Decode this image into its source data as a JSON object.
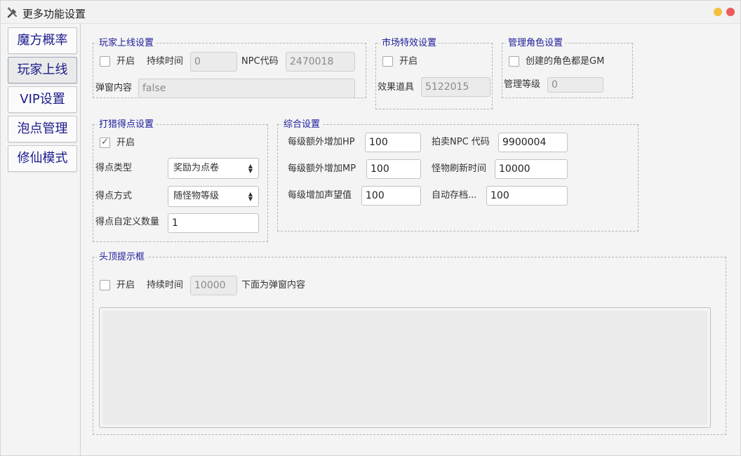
{
  "window": {
    "title": "更多功能设置",
    "colors": {
      "minimize": "#f5bf3e",
      "close": "#f05a5a"
    }
  },
  "sidebar": {
    "items": [
      {
        "label": "魔方概率"
      },
      {
        "label": "玩家上线",
        "active": true
      },
      {
        "label": "VIP设置"
      },
      {
        "label": "泡点管理"
      },
      {
        "label": "修仙模式"
      }
    ]
  },
  "player_online": {
    "legend": "玩家上线设置",
    "enable_label": "开启",
    "enabled": false,
    "duration_label": "持续时间",
    "duration_value": "0",
    "npc_label": "NPC代码",
    "npc_value": "2470018",
    "popup_label": "弹窗内容",
    "popup_value": "false"
  },
  "market": {
    "legend": "市场特效设置",
    "enable_label": "开启",
    "enabled": false,
    "item_label": "效果道具",
    "item_value": "5122015"
  },
  "admin_role": {
    "legend": "管理角色设置",
    "gm_label": "创建的角色都是GM",
    "gm_enabled": false,
    "level_label": "管理等级",
    "level_value": "0"
  },
  "hunting": {
    "legend": "打猎得点设置",
    "enable_label": "开启",
    "enabled": true,
    "type_label": "得点类型",
    "type_value": "奖励为点卷",
    "method_label": "得点方式",
    "method_value": "随怪物等级",
    "custom_label": "得点自定义数量",
    "custom_value": "1"
  },
  "general": {
    "legend": "综合设置",
    "hp_label": "每级额外增加HP",
    "hp_value": "100",
    "mp_label": "每级额外增加MP",
    "mp_value": "100",
    "fame_label": "每级增加声望值",
    "fame_value": "100",
    "auction_label": "拍卖NPC 代码",
    "auction_value": "9900004",
    "refresh_label": "怪物刷新时间",
    "refresh_value": "10000",
    "autosave_label": "自动存档...",
    "autosave_value": "100"
  },
  "head_tip": {
    "legend": "头顶提示框",
    "enable_label": "开启",
    "enabled": false,
    "duration_label": "持续时间",
    "duration_value": "10000",
    "below_label": "下面为弹窗内容",
    "content": ""
  }
}
